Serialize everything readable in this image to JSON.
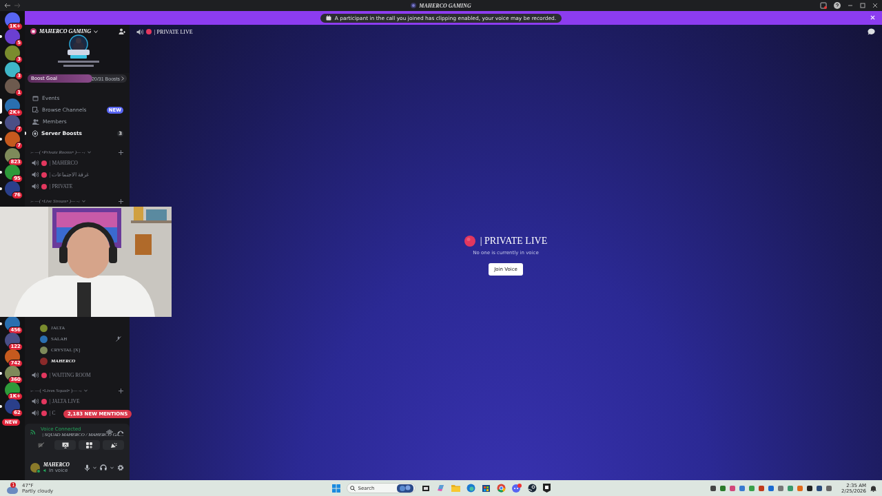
{
  "title_bar": {
    "title": "MAHERCO GAMING"
  },
  "notice": {
    "text": "A participant in the call you joined has clipping enabled, your voice may be recorded."
  },
  "servers_top": [
    {
      "badge": "1K+",
      "unread": false,
      "selected": false
    },
    {
      "badge": "5",
      "unread": true,
      "selected": false
    },
    {
      "badge": "3",
      "unread": false,
      "selected": false
    },
    {
      "badge": "3",
      "unread": false,
      "selected": false
    },
    {
      "badge": "1",
      "unread": false,
      "selected": false
    },
    {
      "badge": "2K+",
      "selected": true
    },
    {
      "badge": "7",
      "unread": true,
      "selected": false
    },
    {
      "badge": "7",
      "unread": true,
      "selected": false
    },
    {
      "badge": "823",
      "unread": false,
      "selected": false
    },
    {
      "badge": "95",
      "unread": true,
      "selected": false
    },
    {
      "badge": "76",
      "unread": true,
      "selected": false
    }
  ],
  "servers_bottom": [
    {
      "badge": "456",
      "unread": true,
      "selected": false
    },
    {
      "badge": "122",
      "unread": false,
      "selected": false
    },
    {
      "badge": "742",
      "unread": false,
      "selected": false
    },
    {
      "badge": "360",
      "unread": true,
      "selected": false
    },
    {
      "badge": "1K+",
      "unread": false,
      "selected": false
    },
    {
      "badge": "62",
      "unread": true,
      "selected": false
    }
  ],
  "new_pill": "NEW",
  "server": {
    "name": "MAHERCO GAMING",
    "boost_label": "Boost Goal",
    "boost_count": "20/31 Boosts",
    "level": 0.65
  },
  "nav": [
    {
      "kind": "events",
      "label": "Events",
      "selected": false
    },
    {
      "kind": "browse",
      "label": "Browse Channels",
      "badge": "NEW",
      "selected": false
    },
    {
      "kind": "members",
      "label": "Members",
      "selected": false
    },
    {
      "kind": "boosts",
      "label": "Server Boosts",
      "count": "3",
      "selected": true
    }
  ],
  "sidebar_top": [
    {
      "kind": "category",
      "label": "›- —( •Private Rooms• )— -‹",
      "italic": true
    },
    {
      "kind": "channel",
      "label": "| MAHERCO"
    },
    {
      "kind": "channel",
      "label": "| غرفة الاجتماعات"
    },
    {
      "kind": "channel",
      "label": "| PRIVATE"
    },
    {
      "kind": "category",
      "label": "›- —( •Live Stream• )— -‹",
      "italic": true
    }
  ],
  "sidebar_bottom": [
    {
      "kind": "member",
      "label": "JALTA",
      "muted": false,
      "self": false
    },
    {
      "kind": "member",
      "label": "SALAH",
      "muted": true,
      "self": false
    },
    {
      "kind": "member",
      "label": "CRYSTAL [X]",
      "muted": false,
      "self": false
    },
    {
      "kind": "member",
      "label": "MAHERCO",
      "muted": false,
      "self": true
    },
    {
      "kind": "channel",
      "label": "| WAITING ROOM"
    },
    {
      "kind": "category",
      "label": "›- —( •Lives Squad• )— -‹",
      "italic": false
    },
    {
      "kind": "channel",
      "label": "| JALTA LIVE"
    },
    {
      "kind": "channel",
      "label": "| C"
    }
  ],
  "mentions_pill": "2,183 NEW MENTIONS",
  "voice": {
    "status": "Voice Connected",
    "channel": "| SQUAD MAHERCO / MAHERCO GA…"
  },
  "user": {
    "name": "MAHERCO",
    "status": "In voice"
  },
  "main": {
    "channel": "| PRIVATE LIVE",
    "empty_title": "| PRIVATE LIVE",
    "empty_text": "No one is currently in voice",
    "join": "Join Voice"
  },
  "taskbar": {
    "weather_badge": "1",
    "temp": "47°F",
    "weather": "Partly cloudy",
    "search": {
      "placeholder": "Search"
    },
    "time": "2:35 AM",
    "date": "2/25/2026"
  }
}
